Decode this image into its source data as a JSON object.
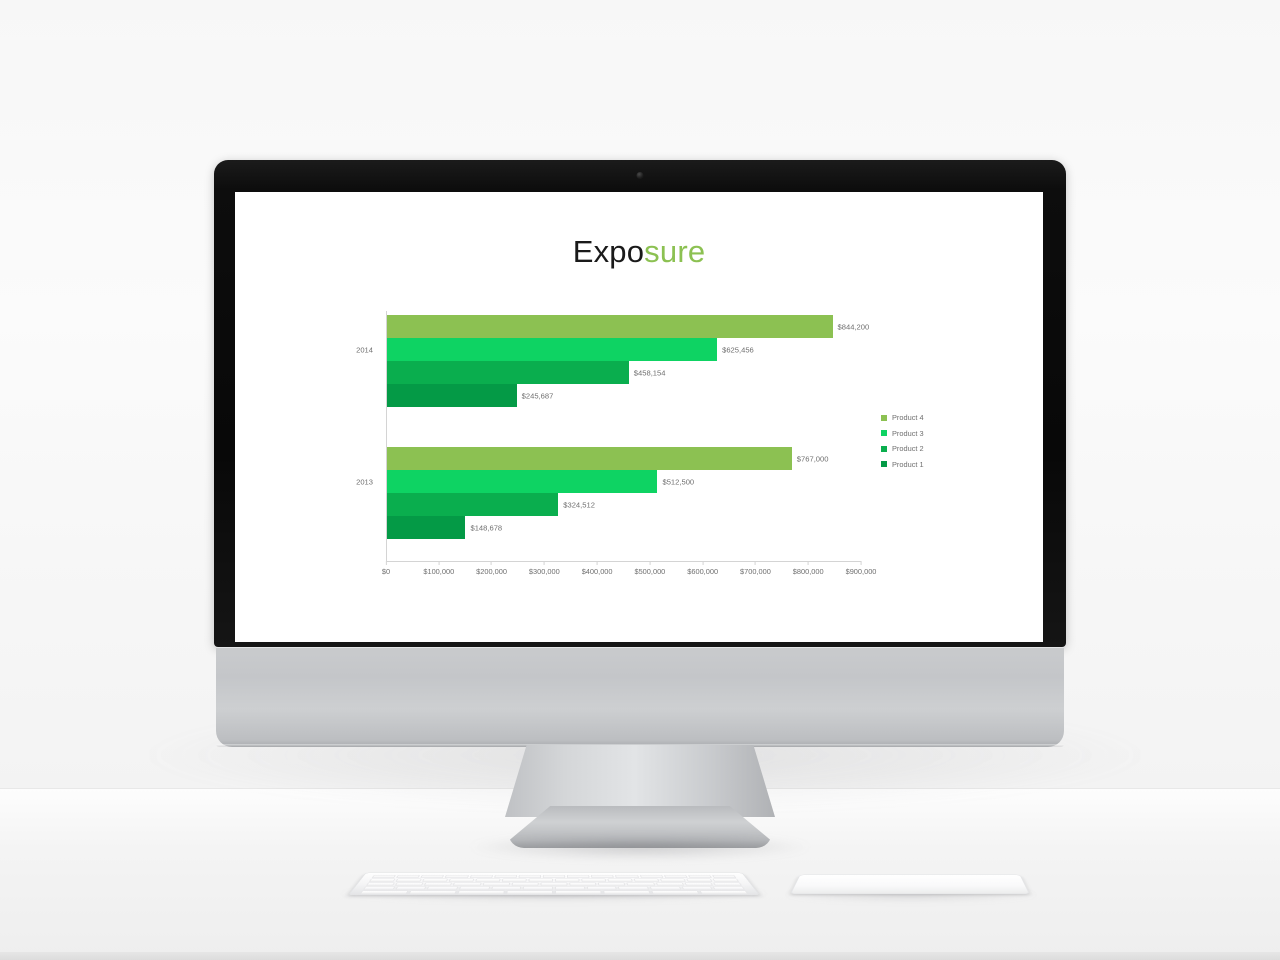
{
  "slide": {
    "title_dark": "Expo",
    "title_accent": "sure"
  },
  "colors": {
    "product4": "#8cc152",
    "product3": "#0ed363",
    "product2": "#0aae4e",
    "product1": "#049a46",
    "title_accent": "#8cc152",
    "axis": "#d4d4d4",
    "text": "#6f6f6f"
  },
  "legend": {
    "position": "right",
    "items": [
      {
        "label": "Product 4",
        "color": "#8cc152"
      },
      {
        "label": "Product 3",
        "color": "#0ed363"
      },
      {
        "label": "Product 2",
        "color": "#0aae4e"
      },
      {
        "label": "Product 1",
        "color": "#049a46"
      }
    ]
  },
  "chart_data": {
    "type": "bar",
    "orientation": "horizontal",
    "title": "Exposure",
    "xlabel": "",
    "ylabel": "",
    "xlim": [
      0,
      900000
    ],
    "grid": false,
    "legend_position": "right",
    "categories": [
      "2014",
      "2013"
    ],
    "x_ticks": [
      "$0",
      "$100,000",
      "$200,000",
      "$300,000",
      "$400,000",
      "$500,000",
      "$600,000",
      "$700,000",
      "$800,000",
      "$900,000"
    ],
    "x_tick_values": [
      0,
      100000,
      200000,
      300000,
      400000,
      500000,
      600000,
      700000,
      800000,
      900000
    ],
    "series": [
      {
        "name": "Product 4",
        "color": "#8cc152",
        "values": [
          844200,
          767000
        ],
        "labels": [
          "$844,200",
          "$767,000"
        ]
      },
      {
        "name": "Product 3",
        "color": "#0ed363",
        "values": [
          625456,
          512500
        ],
        "labels": [
          "$625,456",
          "$512,500"
        ]
      },
      {
        "name": "Product 2",
        "color": "#0aae4e",
        "values": [
          458154,
          324512
        ],
        "labels": [
          "$458,154",
          "$324,512"
        ]
      },
      {
        "name": "Product 1",
        "color": "#049a46",
        "values": [
          245687,
          148678
        ],
        "labels": [
          "$245,687",
          "$148,678"
        ]
      }
    ],
    "groups": [
      {
        "category": "2014",
        "bars": [
          {
            "series": "Product 4",
            "value": 844200,
            "label": "$844,200",
            "color": "#8cc152"
          },
          {
            "series": "Product 3",
            "value": 625456,
            "label": "$625,456",
            "color": "#0ed363"
          },
          {
            "series": "Product 2",
            "value": 458154,
            "label": "$458,154",
            "color": "#0aae4e"
          },
          {
            "series": "Product 1",
            "value": 245687,
            "label": "$245,687",
            "color": "#049a46"
          }
        ]
      },
      {
        "category": "2013",
        "bars": [
          {
            "series": "Product 4",
            "value": 767000,
            "label": "$767,000",
            "color": "#8cc152"
          },
          {
            "series": "Product 3",
            "value": 512500,
            "label": "$512,500",
            "color": "#0ed363"
          },
          {
            "series": "Product 2",
            "value": 324512,
            "label": "$324,512",
            "color": "#0aae4e"
          },
          {
            "series": "Product 1",
            "value": 148678,
            "label": "$148,678",
            "color": "#049a46"
          }
        ]
      }
    ]
  },
  "device": {
    "type": "desktop-computer",
    "peripherals": [
      "keyboard",
      "trackpad"
    ]
  }
}
